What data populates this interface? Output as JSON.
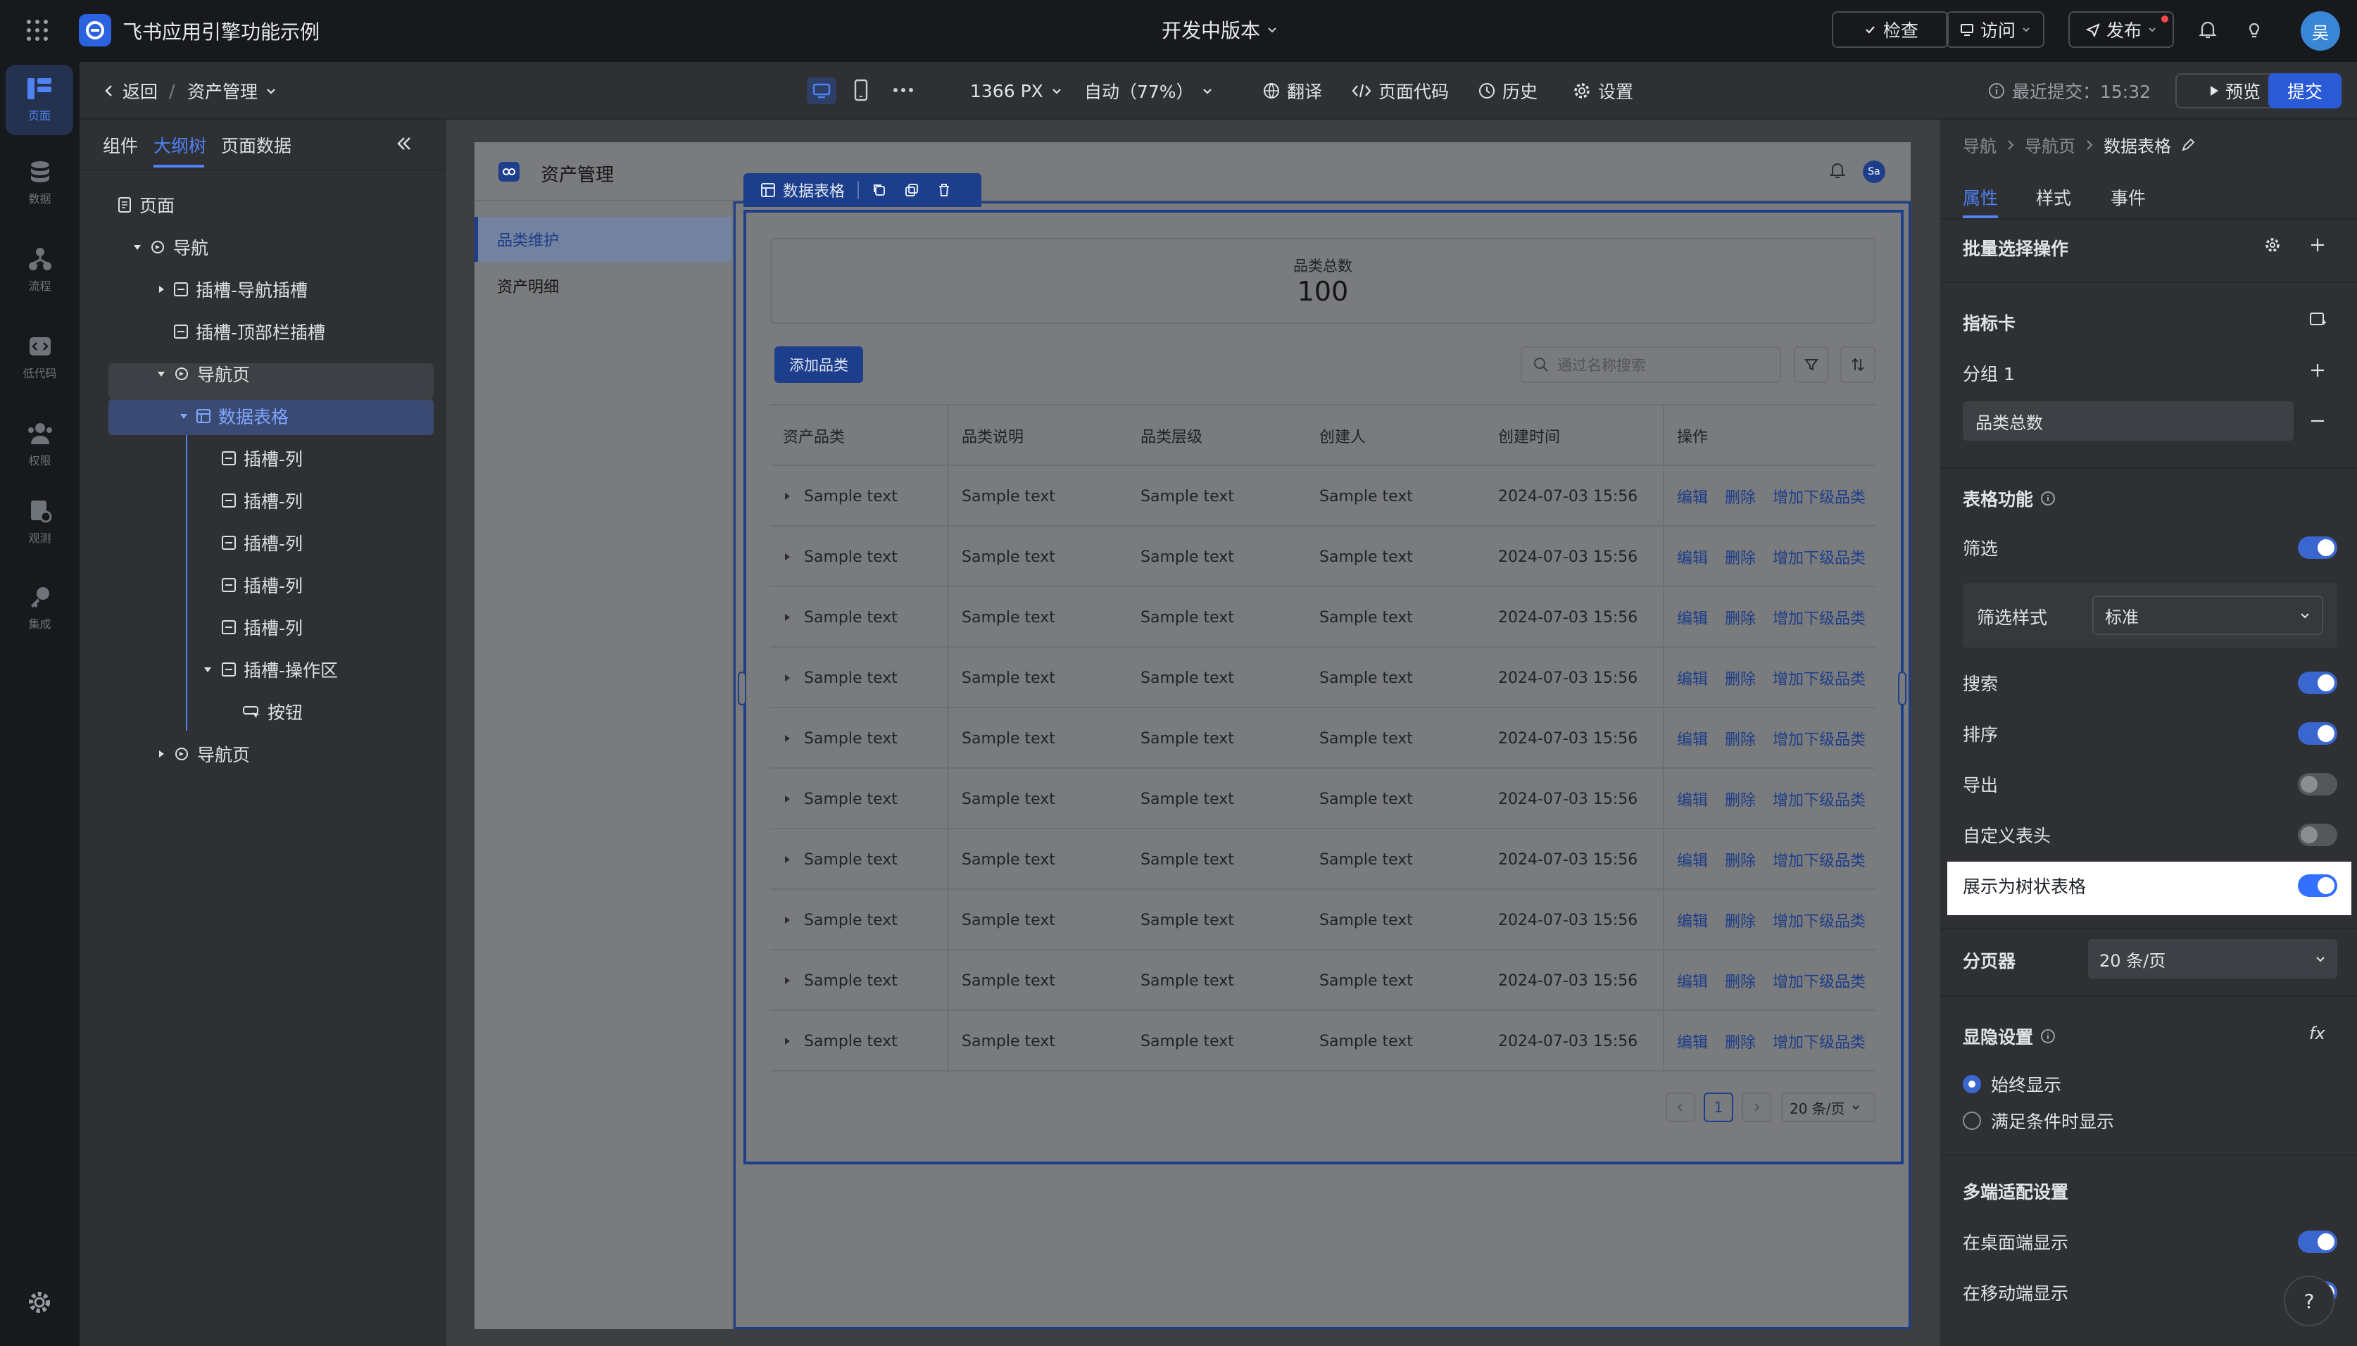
{
  "app": {
    "title": "飞书应用引擎功能示例",
    "version_label": "开发中版本",
    "check_label": "检查",
    "visit_label": "访问",
    "publish_label": "发布",
    "avatar_text": "吴"
  },
  "rail": {
    "items": [
      {
        "label": "页面",
        "icon": "page-icon"
      },
      {
        "label": "数据",
        "icon": "database-icon"
      },
      {
        "label": "流程",
        "icon": "flow-icon"
      },
      {
        "label": "低代码",
        "icon": "code-icon"
      },
      {
        "label": "权限",
        "icon": "users-icon"
      },
      {
        "label": "观测",
        "icon": "monitor-icon"
      },
      {
        "label": "集成",
        "icon": "key-icon"
      }
    ]
  },
  "toolbar": {
    "back_label": "返回",
    "breadcrumb_sep": "/",
    "page_name": "资产管理",
    "width_label": "1366 PX",
    "zoom_label": "自动（77%）",
    "translate_label": "翻译",
    "code_label": "页面代码",
    "history_label": "历史",
    "settings_label": "设置",
    "last_commit": "最近提交：15:32",
    "preview_label": "预览",
    "submit_label": "提交"
  },
  "left_panel": {
    "tabs": [
      "组件",
      "大纲树",
      "页面数据"
    ],
    "active_tab": "大纲树",
    "tree": [
      {
        "label": "页面",
        "icon": "page-icon"
      },
      {
        "label": "导航",
        "icon": "nav-icon"
      },
      {
        "label": "插槽-导航插槽",
        "icon": "slot-icon"
      },
      {
        "label": "插槽-顶部栏插槽",
        "icon": "slot-icon"
      },
      {
        "label": "导航页",
        "icon": "nav-icon"
      },
      {
        "label": "数据表格",
        "icon": "table-icon"
      },
      {
        "label": "插槽-列",
        "icon": "slot-icon"
      },
      {
        "label": "插槽-列",
        "icon": "slot-icon"
      },
      {
        "label": "插槽-列",
        "icon": "slot-icon"
      },
      {
        "label": "插槽-列",
        "icon": "slot-icon"
      },
      {
        "label": "插槽-列",
        "icon": "slot-icon"
      },
      {
        "label": "插槽-操作区",
        "icon": "slot-icon"
      },
      {
        "label": "按钮",
        "icon": "button-icon"
      },
      {
        "label": "导航页",
        "icon": "nav-icon"
      }
    ]
  },
  "page": {
    "title": "资产管理",
    "user_initials": "Sa",
    "menu": [
      "品类维护",
      "资产明细"
    ],
    "selection_label": "数据表格",
    "metric": {
      "label": "品类总数",
      "value": "100"
    },
    "add_button": "添加品类",
    "search_placeholder": "通过名称搜索",
    "table": {
      "columns": [
        "资产品类",
        "品类说明",
        "品类层级",
        "创建人",
        "创建时间",
        "操作"
      ],
      "rows": [
        {
          "c1": "Sample text",
          "c2": "Sample text",
          "c3": "Sample text",
          "c4": "Sample text",
          "time": "2024-07-03 15:56"
        },
        {
          "c1": "Sample text",
          "c2": "Sample text",
          "c3": "Sample text",
          "c4": "Sample text",
          "time": "2024-07-03 15:56"
        },
        {
          "c1": "Sample text",
          "c2": "Sample text",
          "c3": "Sample text",
          "c4": "Sample text",
          "time": "2024-07-03 15:56"
        },
        {
          "c1": "Sample text",
          "c2": "Sample text",
          "c3": "Sample text",
          "c4": "Sample text",
          "time": "2024-07-03 15:56"
        },
        {
          "c1": "Sample text",
          "c2": "Sample text",
          "c3": "Sample text",
          "c4": "Sample text",
          "time": "2024-07-03 15:56"
        },
        {
          "c1": "Sample text",
          "c2": "Sample text",
          "c3": "Sample text",
          "c4": "Sample text",
          "time": "2024-07-03 15:56"
        },
        {
          "c1": "Sample text",
          "c2": "Sample text",
          "c3": "Sample text",
          "c4": "Sample text",
          "time": "2024-07-03 15:56"
        },
        {
          "c1": "Sample text",
          "c2": "Sample text",
          "c3": "Sample text",
          "c4": "Sample text",
          "time": "2024-07-03 15:56"
        },
        {
          "c1": "Sample text",
          "c2": "Sample text",
          "c3": "Sample text",
          "c4": "Sample text",
          "time": "2024-07-03 15:56"
        },
        {
          "c1": "Sample text",
          "c2": "Sample text",
          "c3": "Sample text",
          "c4": "Sample text",
          "time": "2024-07-03 15:56"
        }
      ],
      "actions": {
        "edit": "编辑",
        "delete": "删除",
        "add_child": "增加下级品类"
      }
    },
    "pagination": {
      "current": "1",
      "page_size": "20 条/页"
    }
  },
  "right_panel": {
    "breadcrumb": [
      "导航",
      "导航页",
      "数据表格"
    ],
    "tabs": [
      "属性",
      "样式",
      "事件"
    ],
    "active_tab": "属性",
    "batch_label": "批量选择操作",
    "metric_card_label": "指标卡",
    "group_label": "分组 1",
    "group_item": "品类总数",
    "table_features_label": "表格功能",
    "filter_label": "筛选",
    "filter_style_label": "筛选样式",
    "filter_style_value": "标准",
    "search_label": "搜索",
    "sort_label": "排序",
    "export_label": "导出",
    "custom_header_label": "自定义表头",
    "tree_table_label": "展示为树状表格",
    "pager_label": "分页器",
    "pager_value": "20 条/页",
    "visibility_label": "显隐设置",
    "visibility_options": [
      "始终显示",
      "满足条件时显示"
    ],
    "fx_label": "fx",
    "multi_device_label": "多端适配设置",
    "desktop_label": "在桌面端显示",
    "mobile_label": "在移动端显示",
    "help_label": "?"
  },
  "colors": {
    "accent": "#3370ff",
    "highlight_bg": "#ffffff"
  }
}
